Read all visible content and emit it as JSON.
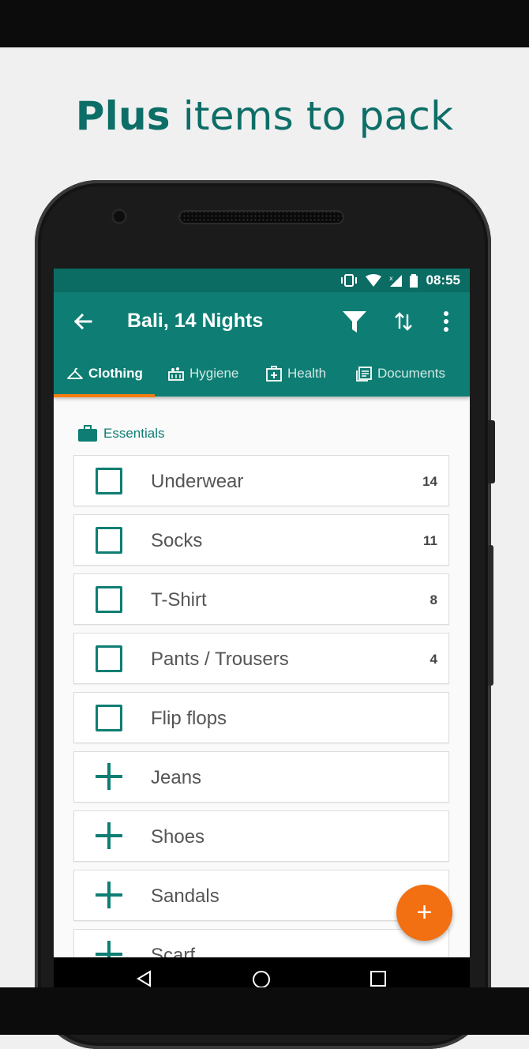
{
  "headline": {
    "bold": "Plus",
    "rest": " items to pack"
  },
  "status": {
    "time": "08:55"
  },
  "appbar": {
    "title": "Bali, 14 Nights"
  },
  "tabs": [
    {
      "label": "Clothing",
      "icon": "hanger-icon",
      "active": true
    },
    {
      "label": "Hygiene",
      "icon": "hygiene-icon",
      "active": false
    },
    {
      "label": "Health",
      "icon": "first-aid-icon",
      "active": false
    },
    {
      "label": "Documents",
      "icon": "documents-icon",
      "active": false
    }
  ],
  "section": {
    "label": "Essentials",
    "icon": "briefcase-icon"
  },
  "items": [
    {
      "name": "Underwear",
      "qty": "14",
      "kind": "checkbox"
    },
    {
      "name": "Socks",
      "qty": "11",
      "kind": "checkbox"
    },
    {
      "name": "T-Shirt",
      "qty": "8",
      "kind": "checkbox"
    },
    {
      "name": "Pants / Trousers",
      "qty": "4",
      "kind": "checkbox"
    },
    {
      "name": "Flip flops",
      "qty": "",
      "kind": "checkbox"
    },
    {
      "name": "Jeans",
      "qty": "",
      "kind": "add"
    },
    {
      "name": "Shoes",
      "qty": "",
      "kind": "add"
    },
    {
      "name": "Sandals",
      "qty": "",
      "kind": "add"
    },
    {
      "name": "Scarf",
      "qty": "",
      "kind": "add"
    }
  ],
  "fab": {
    "label": "+"
  },
  "colors": {
    "primary": "#0e7e74",
    "primary_dark": "#0b6c64",
    "accent": "#f26f12",
    "headline": "#0d6e67"
  }
}
